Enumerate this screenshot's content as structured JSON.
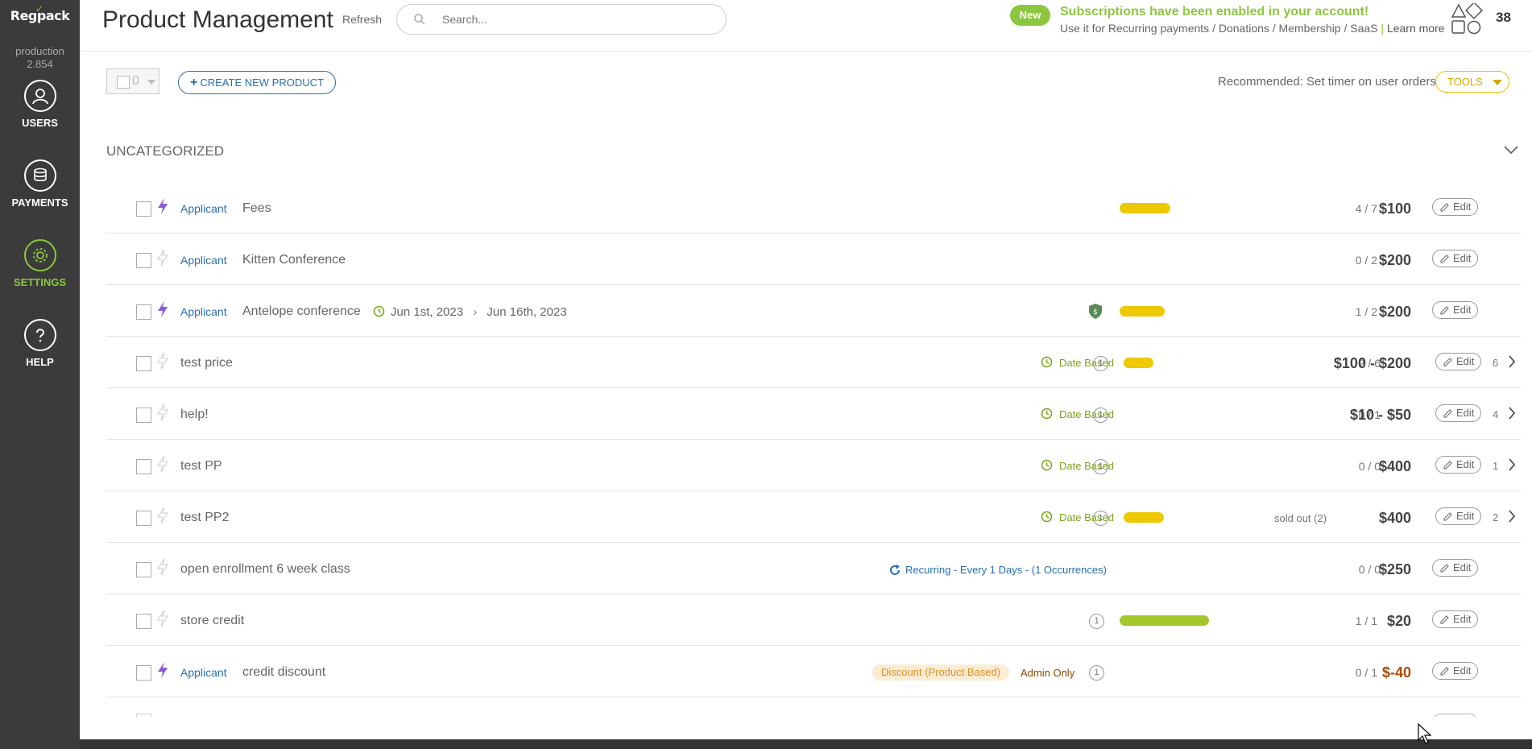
{
  "sidebar": {
    "logo": "Regpack",
    "env_name": "production",
    "env_version": "2.854",
    "items": [
      {
        "label": "USERS",
        "icon": "user-icon"
      },
      {
        "label": "PAYMENTS",
        "icon": "payments-icon"
      },
      {
        "label": "SETTINGS",
        "icon": "gear-icon"
      },
      {
        "label": "HELP",
        "icon": "help-icon"
      }
    ]
  },
  "header": {
    "title": "Product Management",
    "refresh": "Refresh",
    "search_placeholder": "Search...",
    "new_badge": "New",
    "subscription_title": "Subscriptions have been enabled in your account!",
    "subscription_text": "Use it for Recurring payments / Donations / Membership / SaaS",
    "learn_more": "Learn more",
    "shapes_count": "38"
  },
  "toolbar": {
    "selected_count": "0",
    "create_label": "CREATE NEW PRODUCT",
    "recommended": "Recommended: Set timer on user orders",
    "tools_label": "TOOLS"
  },
  "category": "UNCATEGORIZED",
  "rows": [
    {
      "role": "Applicant",
      "name": "Fees",
      "count": "4 / 7",
      "price": "$100",
      "edit": "Edit",
      "fill": 0.57
    },
    {
      "role": "Applicant",
      "name": "Kitten Conference",
      "count": "0 / 2",
      "price": "$200",
      "edit": "Edit"
    },
    {
      "role": "Applicant",
      "name": "Antelope conference",
      "date_start": "Jun 1st, 2023",
      "date_end": "Jun 16th, 2023",
      "count": "1 / 2",
      "price": "$200",
      "edit": "Edit",
      "fill": 0.5
    },
    {
      "name": "test price",
      "type": "Date Based",
      "circle": "1",
      "count": "2 / 6",
      "price": "$100 - $200",
      "edit": "Edit",
      "variants": "6",
      "fill": 0.33
    },
    {
      "name": "help!",
      "type": "Date Based",
      "circle": "1",
      "count": "0 / 1",
      "price": "$10 - $50",
      "edit": "Edit",
      "variants": "4"
    },
    {
      "name": "test PP",
      "type": "Date Based",
      "circle": "1",
      "count": "0 / 0",
      "price": "$400",
      "edit": "Edit",
      "variants": "1"
    },
    {
      "name": "test PP2",
      "type": "Date Based",
      "circle": "1",
      "count": "sold out (2)",
      "price": "$400",
      "edit": "Edit",
      "variants": "2",
      "fill": 0.5
    },
    {
      "name": "open enrollment 6 week class",
      "recurring": "Recurring - Every 1 Days - (1 Occurrences)",
      "count": "0 / 0",
      "price": "$250",
      "edit": "Edit"
    },
    {
      "name": "store credit",
      "circle": "1",
      "count": "1 / 1",
      "price": "$20",
      "edit": "Edit",
      "fill": 1.0
    },
    {
      "role": "Applicant",
      "name": "credit discount",
      "discount": "Discount (Product Based)",
      "admin_only": "Admin Only",
      "circle": "1",
      "count": "0 / 1",
      "price": "$-40",
      "edit": "Edit"
    }
  ],
  "colors": {
    "sidebar_bg": "#3b3b3b",
    "accent_green": "#8cc63f",
    "link_blue": "#2a6fb0",
    "bar_yellow": "#ecc900",
    "bar_green": "#a4c82c"
  }
}
